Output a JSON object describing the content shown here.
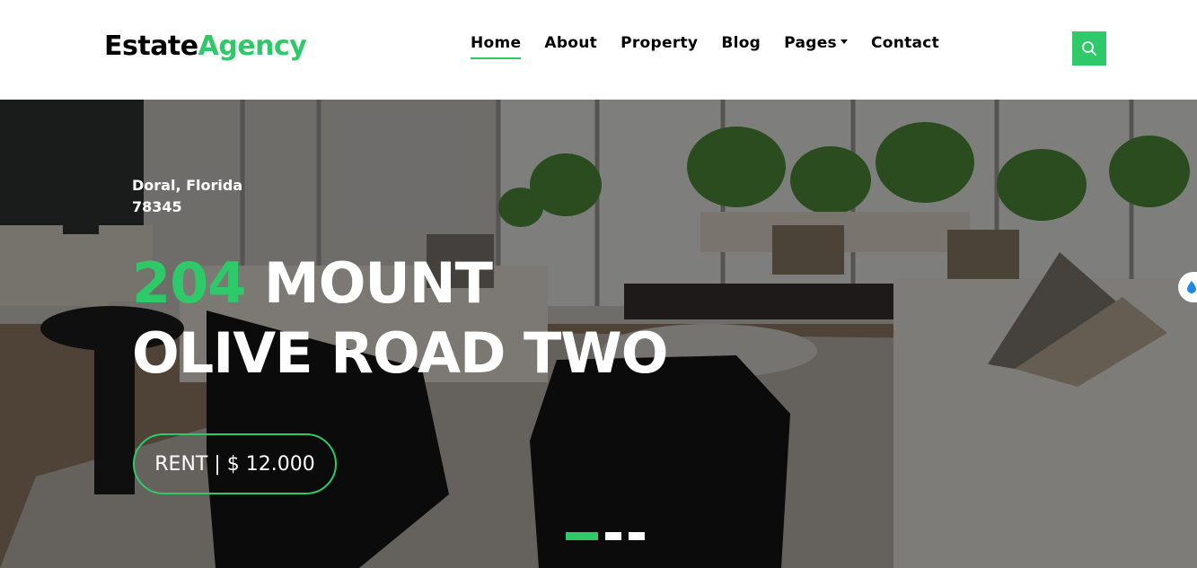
{
  "brand": {
    "part1": "Estate",
    "part2": "Agency"
  },
  "nav": {
    "items": [
      {
        "label": "Home"
      },
      {
        "label": "About"
      },
      {
        "label": "Property"
      },
      {
        "label": "Blog"
      },
      {
        "label": "Pages"
      },
      {
        "label": "Contact"
      }
    ],
    "active_item": "Home",
    "search_icon": "search-icon"
  },
  "hero": {
    "location_line1": "Doral, Florida",
    "location_line2": "78345",
    "title_number": "204",
    "title_rest_line1": " MOUNT",
    "title_line2": "OLIVE ROAD TWO",
    "rent_button": "RENT | $ 12.000",
    "slide_count": 3,
    "active_slide": 1
  },
  "colors": {
    "accent": "#2eca6a",
    "text": "#000000",
    "hero_text": "#ffffff"
  }
}
